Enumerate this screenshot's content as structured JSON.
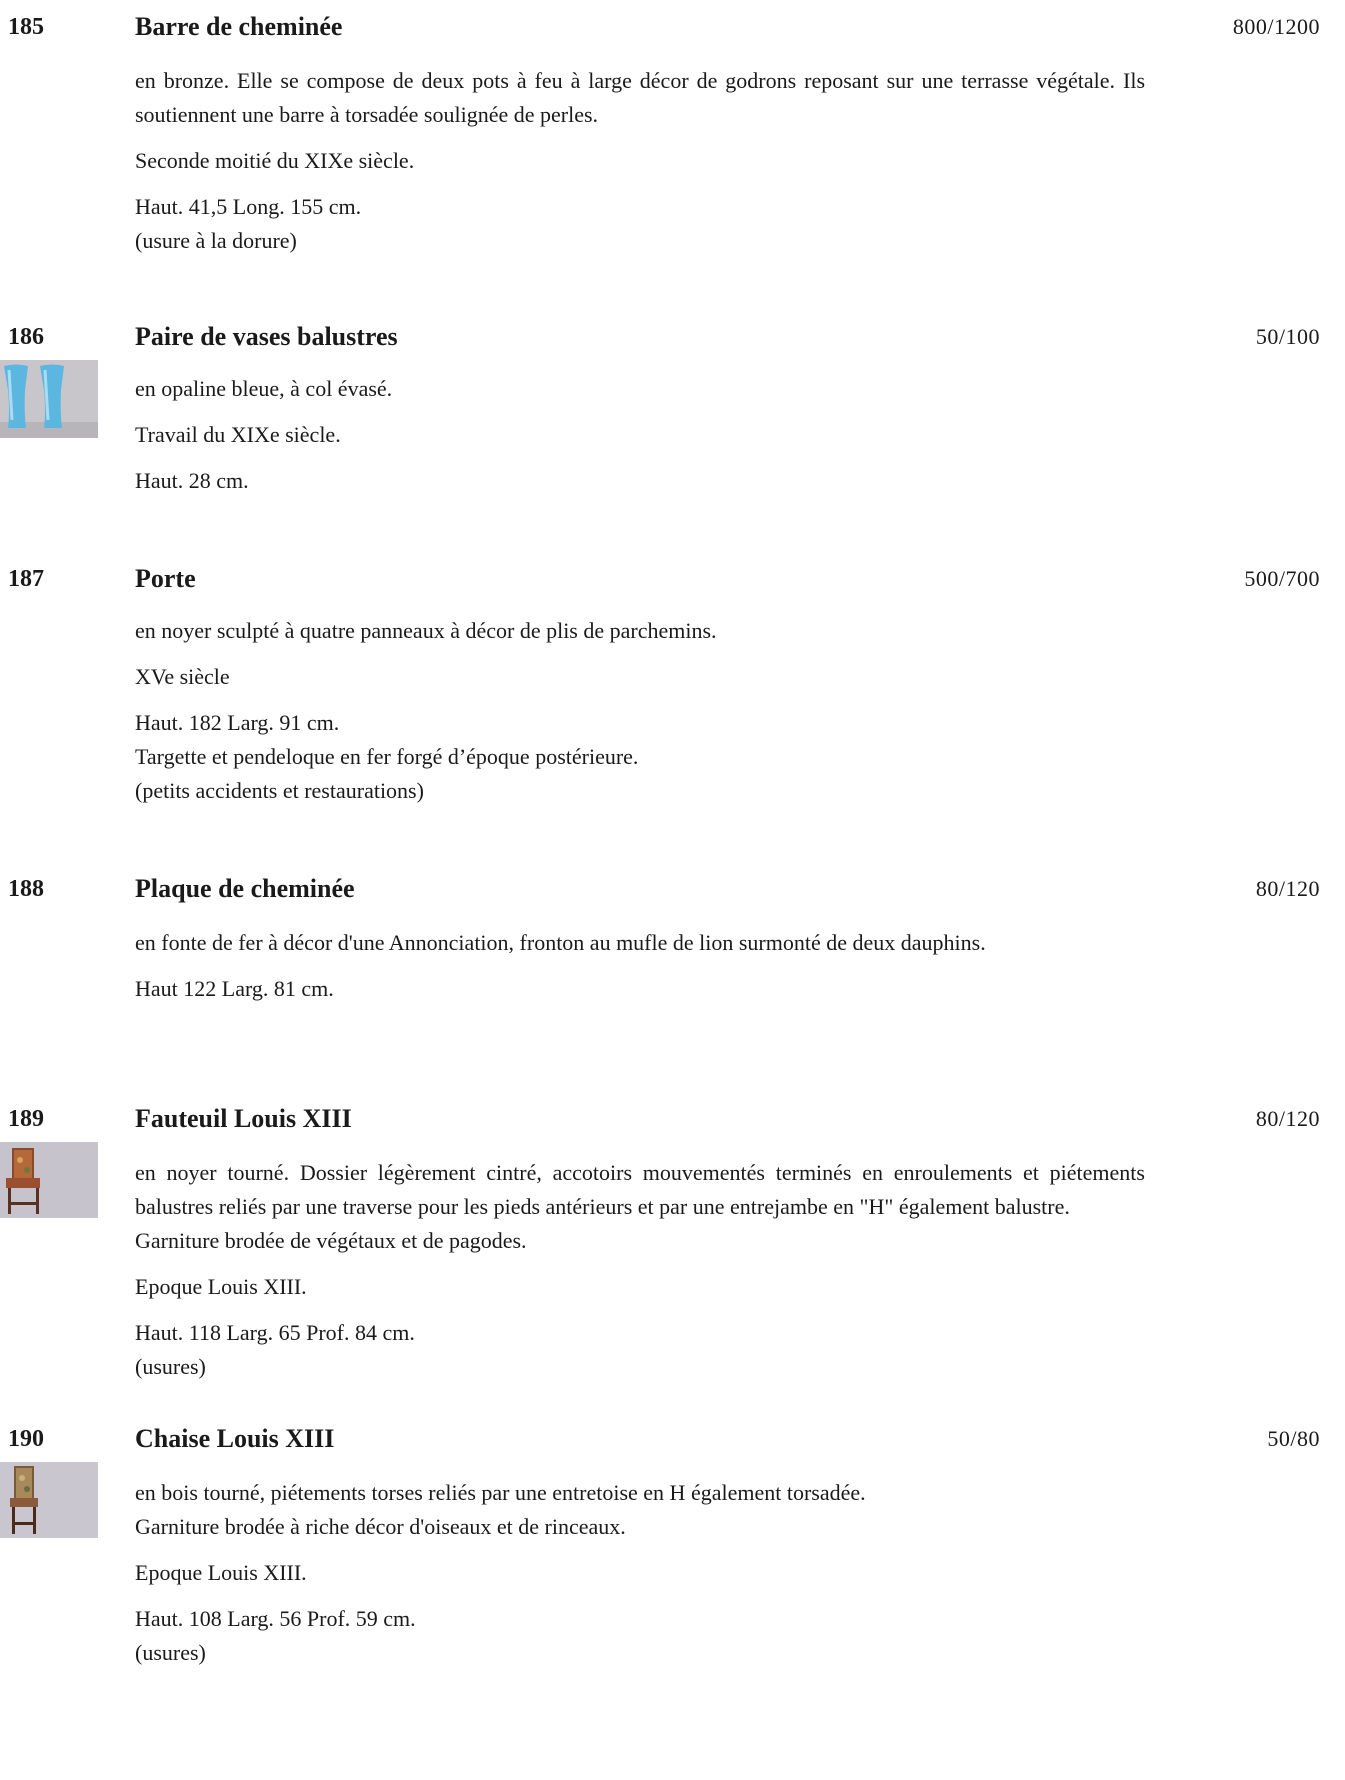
{
  "lots": [
    {
      "number": "185",
      "title": "Barre de cheminée",
      "estimate": "800/1200",
      "description": "en bronze. Elle se compose de deux pots à feu à large décor de godrons reposant sur une terrasse végétale. Ils soutiennent une barre à torsadée soulignée de perles.",
      "period": "Seconde moitié du XIXe siècle.",
      "dimensions": "Haut. 41,5 Long. 155 cm.",
      "note": "(usure à la dorure)"
    },
    {
      "number": "186",
      "title": "Paire de vases balustres",
      "estimate": "50/100",
      "description": "en opaline bleue, à col évasé.",
      "period": "Travail du XIXe siècle.",
      "dimensions": "Haut. 28 cm.",
      "thumbnail": "blue-opaline-vases"
    },
    {
      "number": "187",
      "title": "Porte",
      "estimate": "500/700",
      "description": "en noyer sculpté à quatre panneaux à décor de plis de parchemins.",
      "period": "XVe siècle",
      "dimensions": "Haut. 182 Larg. 91 cm.",
      "note_line1": "Targette et pendeloque en fer forgé d’époque postérieure.",
      "note_line2": "(petits accidents et restaurations)"
    },
    {
      "number": "188",
      "title": "Plaque de cheminée",
      "estimate": "80/120",
      "description": "en fonte de fer à décor d'une Annonciation, fronton au mufle de lion surmonté de deux dauphins.",
      "dimensions": "Haut 122 Larg. 81 cm."
    },
    {
      "number": "189",
      "title": "Fauteuil Louis XIII",
      "estimate": "80/120",
      "description": "en noyer tourné. Dossier légèrement cintré, accotoirs mouvementés terminés en enroulements et piétements balustres reliés par une traverse pour les pieds antérieurs et par une entrejambe en \"H\" également balustre.",
      "description_2": "Garniture brodée de végétaux et de pagodes.",
      "period": "Epoque Louis XIII.",
      "dimensions": "Haut. 118 Larg. 65 Prof. 84 cm.",
      "note": "(usures)",
      "thumbnail": "armchair-photo"
    },
    {
      "number": "190",
      "title": "Chaise Louis XIII",
      "estimate": "50/80",
      "description": "en bois tourné, piétements torses reliés par une entretoise en H également torsadée.",
      "description_2": "Garniture brodée à riche décor d'oiseaux et de rinceaux.",
      "period": "Epoque Louis XIII.",
      "dimensions": "Haut. 108 Larg. 56 Prof. 59 cm.",
      "note": "(usures)",
      "thumbnail": "chair-photo"
    }
  ]
}
